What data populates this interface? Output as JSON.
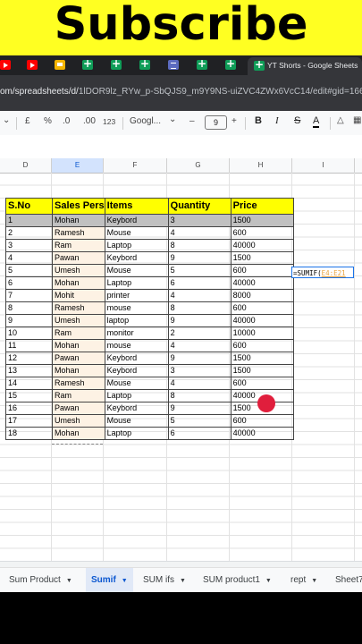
{
  "banner": {
    "text": "Subscribe",
    "background": "#ffff22"
  },
  "browser": {
    "active_tab_title": "YT Shorts - Google Sheets",
    "url_prefix": "om/spreadsheets/d/",
    "url_rest": "1lDOR9lz_RYw_p-SbQJS9_m9Y9NS-uiZVC4ZWx6VcC14/edit#gid=1664909"
  },
  "toolbar": {
    "currency": "£",
    "percent": "%",
    "decrease_decimal": ".0",
    "increase_decimal": ".00",
    "number_format": "123",
    "font_name": "Googl...",
    "font_size": "9",
    "bold": "B",
    "italic": "I",
    "strikethrough": "S",
    "text_color": "A"
  },
  "columns": [
    "D",
    "E",
    "F",
    "G",
    "H",
    "I"
  ],
  "table": {
    "headers": [
      "S.No",
      "Sales Pers",
      "Items",
      "Quantity",
      "Price"
    ],
    "rows": [
      [
        "1",
        "Mohan",
        "Keybord",
        "3",
        "1500"
      ],
      [
        "2",
        "Ramesh",
        "Mouse",
        "4",
        "600"
      ],
      [
        "3",
        "Ram",
        "Laptop",
        "8",
        "40000"
      ],
      [
        "4",
        "Pawan",
        "Keybord",
        "9",
        "1500"
      ],
      [
        "5",
        "Umesh",
        "Mouse",
        "5",
        "600"
      ],
      [
        "6",
        "Mohan",
        "Laptop",
        "6",
        "40000"
      ],
      [
        "7",
        "Mohit",
        "printer",
        "4",
        "8000"
      ],
      [
        "8",
        "Ramesh",
        "mouse",
        "8",
        "600"
      ],
      [
        "9",
        "Umesh",
        "laptop",
        "9",
        "40000"
      ],
      [
        "10",
        "Ram",
        "monitor",
        "2",
        "10000"
      ],
      [
        "11",
        "Mohan",
        "mouse",
        "4",
        "600"
      ],
      [
        "12",
        "Pawan",
        "Keybord",
        "9",
        "1500"
      ],
      [
        "13",
        "Mohan",
        "Keybord",
        "3",
        "1500"
      ],
      [
        "14",
        "Ramesh",
        "Mouse",
        "4",
        "600"
      ],
      [
        "15",
        "Ram",
        "Laptop",
        "8",
        "40000"
      ],
      [
        "16",
        "Pawan",
        "Keybord",
        "9",
        "1500"
      ],
      [
        "17",
        "Umesh",
        "Mouse",
        "5",
        "600"
      ],
      [
        "18",
        "Mohan",
        "Laptop",
        "6",
        "40000"
      ]
    ]
  },
  "formula": {
    "prefix": "=SUMIF(",
    "range": "E4:E21"
  },
  "sheet_tabs": [
    {
      "label": "Sum Product",
      "caret": "▼"
    },
    {
      "label": "Sumif",
      "caret": "▼"
    },
    {
      "label": "SUM ifs",
      "caret": "▼"
    },
    {
      "label": "SUM product1",
      "caret": "▼"
    },
    {
      "label": "rept",
      "caret": "▼"
    },
    {
      "label": "Sheet7",
      "caret": ""
    }
  ],
  "colors": {
    "header_fill": "#ffff00",
    "highlight_row": "#c0c0c0",
    "accent": "#1a73e8"
  }
}
